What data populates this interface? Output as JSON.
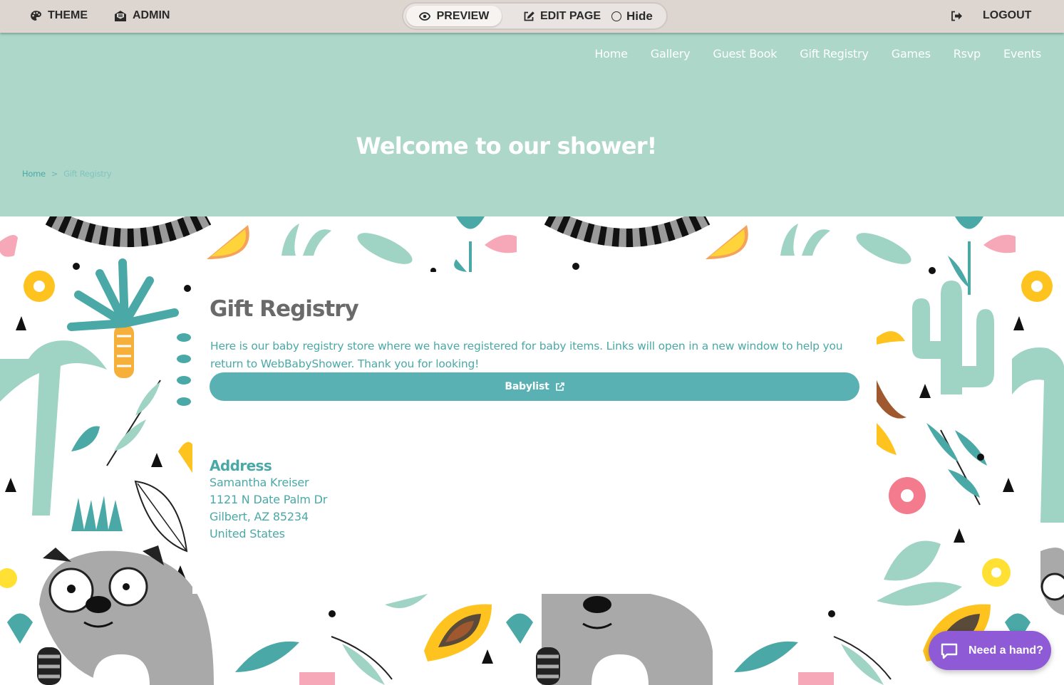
{
  "admin_bar": {
    "theme_label": "THEME",
    "admin_label": "ADMIN",
    "preview_label": "PREVIEW",
    "edit_label": "EDIT PAGE",
    "hide_label": "Hide",
    "logout_label": "LOGOUT"
  },
  "nav": {
    "items": [
      {
        "label": "Home"
      },
      {
        "label": "Gallery"
      },
      {
        "label": "Guest Book"
      },
      {
        "label": "Gift Registry"
      },
      {
        "label": "Games"
      },
      {
        "label": "Rsvp"
      },
      {
        "label": "Events"
      }
    ]
  },
  "hero": {
    "title": "Welcome to our shower!"
  },
  "breadcrumb": {
    "home": "Home",
    "separator": ">",
    "current": "Gift Registry"
  },
  "content": {
    "title": "Gift Registry",
    "intro": "Here is our baby registry store where we have registered for baby items. Links will open in a new window to help you return to WebBabyShower. Thank you for looking!",
    "registry_button": "Babylist",
    "address_heading": "Address",
    "address_lines": [
      "Samantha Kreiser",
      "1121 N Date Palm Dr",
      "Gilbert, AZ 85234",
      "United States"
    ]
  },
  "help": {
    "label": "Need a hand?"
  },
  "colors": {
    "header_bg": "#acd7c9",
    "accent_teal": "#4aa9a6",
    "button_teal": "#5ab1b4",
    "admin_bar_bg": "#ddd5d0",
    "help_purple": "#8f5ad6",
    "title_gray": "#6a6a6a"
  },
  "icons": {
    "theme": "palette-icon",
    "admin": "envelope-open-icon",
    "preview": "eye-icon",
    "edit": "edit-icon",
    "logout": "sign-out-icon",
    "external": "external-link-icon",
    "help": "chat-bubble-icon"
  }
}
